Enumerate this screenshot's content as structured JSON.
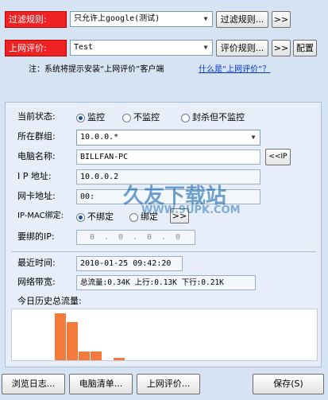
{
  "filter_rule": {
    "label": "过滤规则:",
    "value": "只允许上google(测试)",
    "button": "过滤规则...",
    "more": ">>"
  },
  "online_eval": {
    "label": "上网评价:",
    "value": "Test",
    "button": "评价规则...",
    "more": ">>",
    "config": "配置"
  },
  "notice": {
    "text": "注：系统将提示安装“上网评价”客户端",
    "link": "什么是“上网评价”？"
  },
  "status": {
    "label": "当前状态:",
    "options": [
      "监控",
      "不监控",
      "封杀但不监控"
    ],
    "selected": 0
  },
  "group": {
    "label": "所在群组:",
    "value": "10.0.0.*"
  },
  "pc_name": {
    "label": "电脑名称:",
    "value": "BILLFAN-PC",
    "button": "<<IP"
  },
  "ip": {
    "label": "I P 地址:",
    "value": "10.0.0.2"
  },
  "mac": {
    "label": "网卡地址:",
    "value": "00:"
  },
  "ip_mac": {
    "label": "IP-MAC绑定:",
    "options": [
      "不绑定",
      "绑定"
    ],
    "selected": 0,
    "button": ">>"
  },
  "bind_ip": {
    "label": "要绑的IP:",
    "octets": [
      "0",
      "0",
      "0",
      "0"
    ],
    "separators": [
      ".",
      ".",
      "."
    ]
  },
  "last_time": {
    "label": "最近时间:",
    "value": "2010-01-25 09:42:20"
  },
  "bandwidth": {
    "label": "网络带宽:",
    "value": "总流量:0.34K 上行:0.13K 下行:0.21K"
  },
  "history": {
    "label": "今日历史总流量:"
  },
  "chart_data": {
    "type": "bar",
    "values": [
      0,
      0,
      0,
      0,
      0,
      0,
      0,
      0,
      0,
      0,
      0,
      0,
      0,
      0,
      0,
      0,
      0,
      0,
      0,
      0,
      0,
      0,
      0,
      0,
      0,
      0,
      0,
      0,
      0,
      0,
      0,
      0,
      0,
      0,
      0,
      0,
      0,
      0,
      0,
      0,
      0,
      0,
      0,
      0,
      0,
      0,
      0,
      0,
      0,
      0,
      0,
      0,
      0,
      0,
      0,
      0,
      0,
      0,
      0,
      0,
      0,
      0,
      0,
      0,
      0,
      0,
      0,
      0,
      0,
      0,
      0,
      0,
      0,
      0,
      0,
      0,
      0,
      0,
      0,
      0,
      0,
      0,
      0,
      0,
      0,
      0,
      0,
      0,
      0,
      0,
      0,
      0,
      0,
      0,
      0,
      0,
      0,
      0,
      0,
      0,
      0,
      0,
      0,
      0,
      0,
      0,
      0,
      0,
      0,
      0,
      0,
      0,
      0,
      0,
      0,
      0,
      0,
      0,
      0,
      0,
      0,
      0,
      0,
      0,
      0,
      0,
      0,
      0,
      0,
      0,
      0,
      0,
      0,
      0,
      0,
      0,
      0,
      0,
      0,
      0,
      0,
      0,
      0,
      0,
      0,
      0,
      0,
      0,
      0,
      0,
      0,
      0,
      0,
      0,
      0,
      0,
      0,
      0,
      0,
      0,
      0,
      0,
      0,
      0,
      0,
      0,
      0,
      0,
      0,
      0,
      0,
      0,
      0,
      0,
      0,
      0,
      0,
      0,
      0,
      0,
      0,
      0,
      0,
      0,
      0,
      0,
      0,
      0,
      0,
      0,
      0,
      0,
      0,
      0,
      0,
      0,
      0,
      0,
      0,
      0,
      0,
      0,
      0,
      0,
      0,
      0,
      0,
      0,
      0,
      0,
      0,
      0,
      0,
      0,
      0,
      0,
      0,
      0,
      0,
      0,
      0,
      0,
      0,
      0,
      0,
      0,
      0,
      0,
      0,
      0,
      0,
      0,
      0,
      0,
      0,
      0,
      0,
      0,
      0,
      0,
      0,
      0,
      0,
      0,
      0,
      0,
      0,
      0,
      0,
      0,
      0,
      0,
      0,
      0,
      0,
      0,
      0,
      0,
      0,
      0,
      0,
      0,
      0,
      0,
      0,
      0,
      0,
      0,
      0,
      0,
      0,
      0,
      0,
      0,
      0,
      0,
      0,
      0,
      0,
      0,
      0,
      0
    ],
    "visible_bars": [
      {
        "slot": 0,
        "value": 0.0
      },
      {
        "slot": 1,
        "value": 0.0
      },
      {
        "slot": 2,
        "value": 0.0
      },
      {
        "slot": 3,
        "value": 0.0
      },
      {
        "slot": 4,
        "value": 0.0
      },
      {
        "slot": 5,
        "value": 0.0
      },
      {
        "slot": 6,
        "value": 0.0
      }
    ],
    "bars": [
      0,
      0,
      0,
      0,
      0,
      0,
      0
    ],
    "series_bars": [
      0.95,
      0.77,
      0.18,
      0.18,
      0.05,
      0.0,
      0.0
    ],
    "title": "",
    "xlabel": "",
    "ylabel": ""
  },
  "bottom": {
    "log": "浏览日志...",
    "pcs": "电脑清单...",
    "eval": "上网评价...",
    "save": "保存(S)"
  },
  "watermark": {
    "cn": "久友下载站",
    "en": "WWW.9UPK.COM"
  }
}
